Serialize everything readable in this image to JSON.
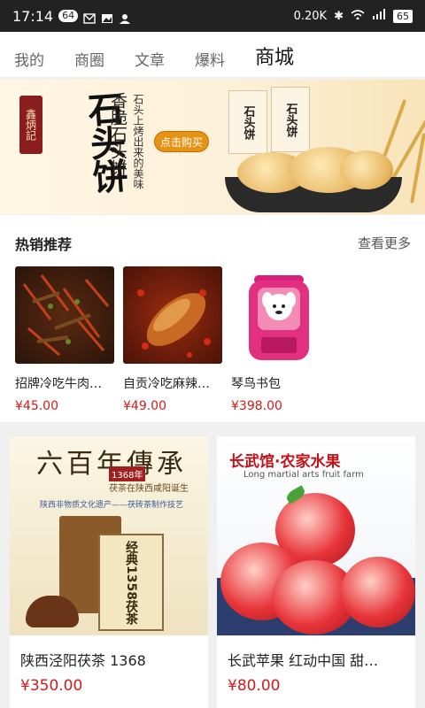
{
  "status_bar": {
    "time": "17:14",
    "badge": "64",
    "net_speed": "0.20K",
    "battery": "65"
  },
  "tabs": [
    {
      "label": "我的"
    },
    {
      "label": "商圈"
    },
    {
      "label": "文章"
    },
    {
      "label": "爆料"
    },
    {
      "label": "商城",
      "active": true
    }
  ],
  "banner": {
    "brand": "鑫炳記",
    "headline": "石头饼",
    "subtitle": "香脆石头饼",
    "tagline": "石头上烤出来的美味",
    "cta": "点击购买",
    "package_text": "石头饼"
  },
  "hot": {
    "title": "热销推荐",
    "more": "查看更多",
    "items": [
      {
        "name": "招牌冷吃牛肉…",
        "price": "¥45.00"
      },
      {
        "name": "自贡冷吃麻辣…",
        "price": "¥49.00"
      },
      {
        "name": "琴鸟书包",
        "price": "¥398.00"
      }
    ]
  },
  "cards": [
    {
      "name": "陕西泾阳茯茶 1368",
      "price": "¥350.00",
      "img_title": "六百年傳承",
      "img_tag": "1368年",
      "img_sub": "茯茶在陕西咸阳诞生",
      "img_desc": "陕西非物质文化遗产——茯砖茶制作技艺",
      "box_text": "经典1358茯茶"
    },
    {
      "name": "长武苹果 红动中国 甜…",
      "price": "¥80.00",
      "img_brand": "长武馆·农家水果",
      "img_en": "Long martial arts fruit farm"
    }
  ],
  "colors": {
    "price": "#d41b1b",
    "cta": "#e59314"
  }
}
